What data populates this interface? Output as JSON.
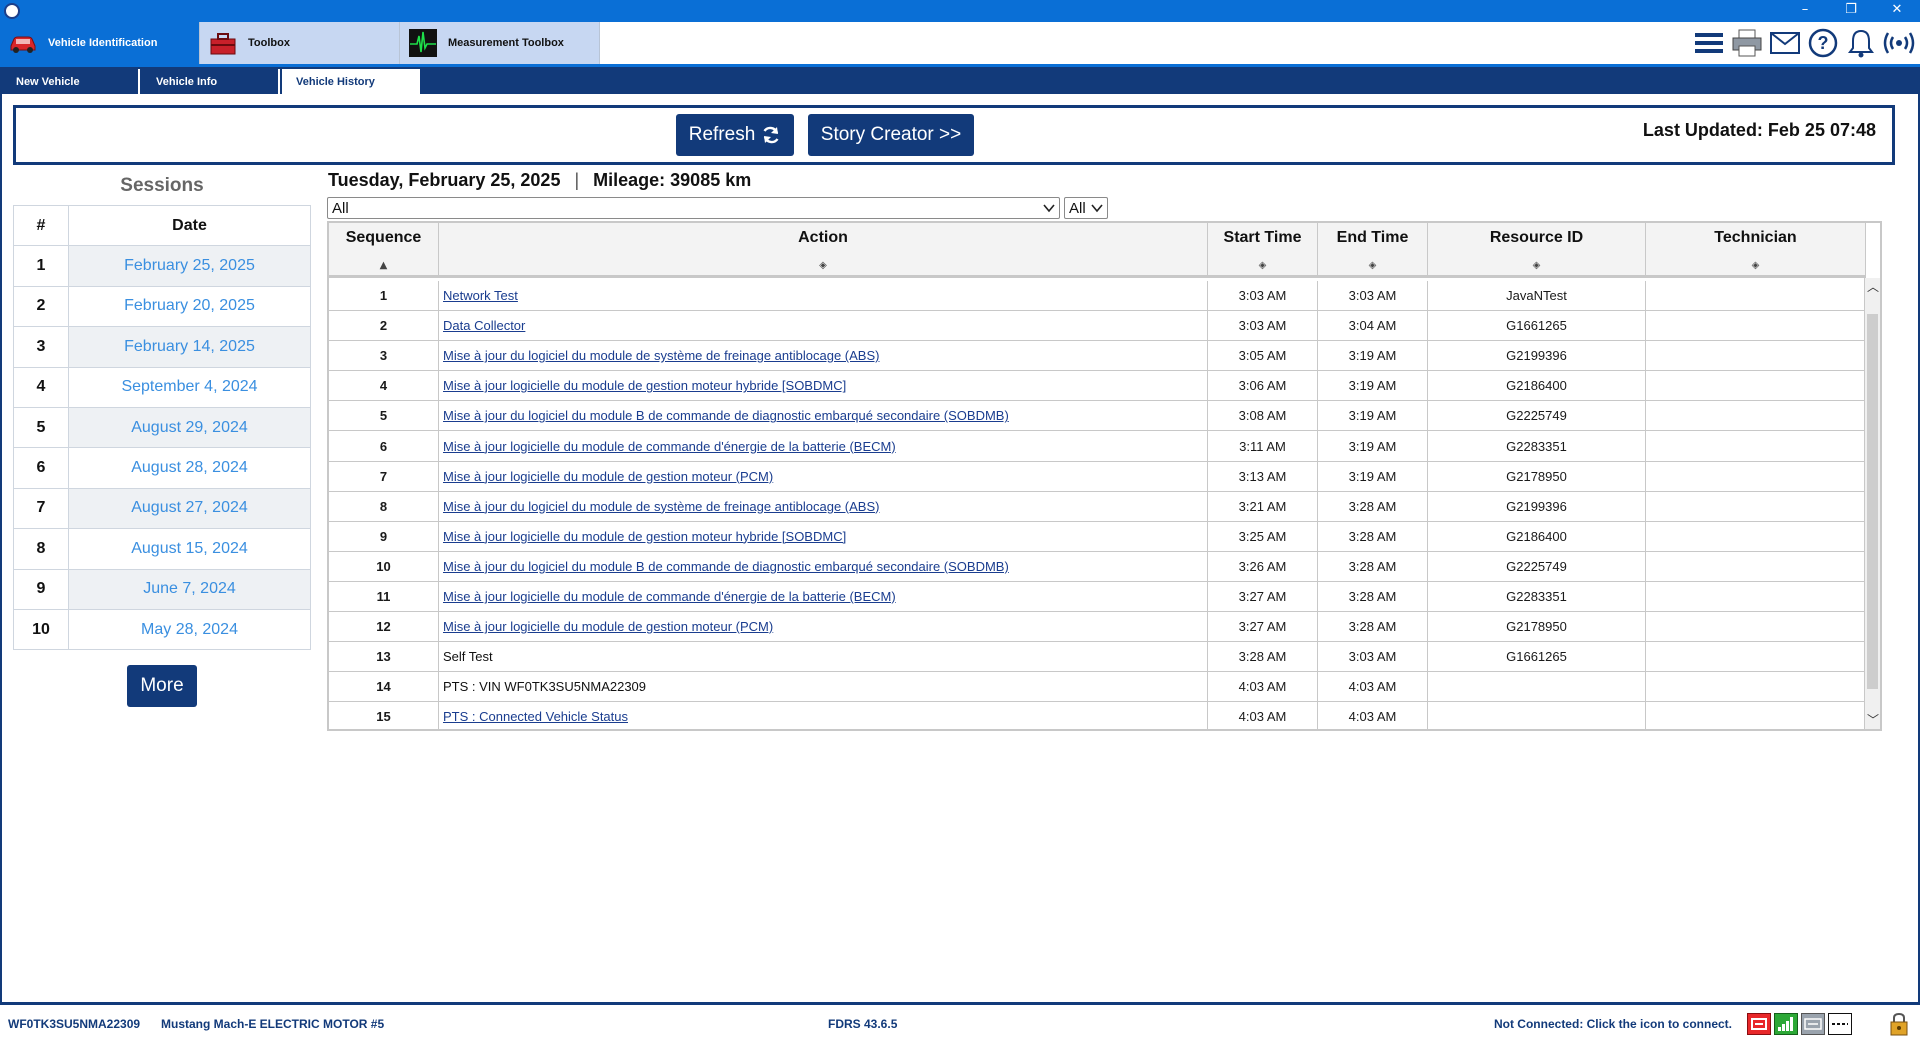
{
  "window": {
    "minimize": "–",
    "restore": "❐",
    "close": "✕"
  },
  "main_tabs": [
    {
      "label": "Vehicle Identification",
      "icon": "car-icon",
      "active": true
    },
    {
      "label": "Toolbox",
      "icon": "toolbox-icon",
      "active": false
    },
    {
      "label": "Measurement Toolbox",
      "icon": "oscilloscope-icon",
      "active": false
    }
  ],
  "tool_icons": [
    "menu-icon",
    "printer-icon",
    "mail-icon",
    "help-icon",
    "bell-icon",
    "broadcast-icon"
  ],
  "sub_tabs": [
    {
      "label": "New Vehicle",
      "active": false
    },
    {
      "label": "Vehicle Info",
      "active": false
    },
    {
      "label": "Vehicle History",
      "active": true
    }
  ],
  "actions": {
    "refresh_label": "Refresh",
    "story_creator_label": "Story Creator >>",
    "last_updated": "Last Updated: Feb 25 07:48"
  },
  "sessions": {
    "title": "Sessions",
    "col_num": "#",
    "col_date": "Date",
    "rows": [
      {
        "num": "1",
        "date": "February 25, 2025"
      },
      {
        "num": "2",
        "date": "February 20, 2025"
      },
      {
        "num": "3",
        "date": "February 14, 2025"
      },
      {
        "num": "4",
        "date": "September 4, 2024"
      },
      {
        "num": "5",
        "date": "August 29, 2024"
      },
      {
        "num": "6",
        "date": "August 28, 2024"
      },
      {
        "num": "7",
        "date": "August 27, 2024"
      },
      {
        "num": "8",
        "date": "August 15, 2024"
      },
      {
        "num": "9",
        "date": "June 7, 2024"
      },
      {
        "num": "10",
        "date": "May 28, 2024"
      }
    ],
    "more_label": "More"
  },
  "detail": {
    "date_heading": "Tuesday, February 25, 2025",
    "separator": "|",
    "mileage": "Mileage: 39085 km",
    "filter_main": "All",
    "filter_small": "All"
  },
  "history": {
    "columns": [
      "Sequence",
      "Action",
      "Start Time",
      "End Time",
      "Resource ID",
      "Technician"
    ],
    "rows": [
      {
        "seq": "1",
        "action": "Network Test",
        "link": true,
        "start": "3:03 AM",
        "end": "3:03 AM",
        "resource": "JavaNTest",
        "tech": ""
      },
      {
        "seq": "2",
        "action": "Data Collector",
        "link": true,
        "start": "3:03 AM",
        "end": "3:04 AM",
        "resource": "G1661265",
        "tech": ""
      },
      {
        "seq": "3",
        "action": "Mise à jour du logiciel du module de système de freinage antiblocage (ABS)",
        "link": true,
        "start": "3:05 AM",
        "end": "3:19 AM",
        "resource": "G2199396",
        "tech": ""
      },
      {
        "seq": "4",
        "action": "Mise à jour logicielle du module de gestion moteur hybride [SOBDMC]",
        "link": true,
        "start": "3:06 AM",
        "end": "3:19 AM",
        "resource": "G2186400",
        "tech": ""
      },
      {
        "seq": "5",
        "action": "Mise à jour du logiciel du module B de commande de diagnostic embarqué secondaire (SOBDMB)",
        "link": true,
        "start": "3:08 AM",
        "end": "3:19 AM",
        "resource": "G2225749",
        "tech": ""
      },
      {
        "seq": "6",
        "action": "Mise à jour logicielle du module de commande d'énergie de la batterie (BECM)",
        "link": true,
        "start": "3:11 AM",
        "end": "3:19 AM",
        "resource": "G2283351",
        "tech": ""
      },
      {
        "seq": "7",
        "action": "Mise à jour logicielle du module de gestion moteur (PCM)",
        "link": true,
        "start": "3:13 AM",
        "end": "3:19 AM",
        "resource": "G2178950",
        "tech": ""
      },
      {
        "seq": "8",
        "action": "Mise à jour du logiciel du module de système de freinage antiblocage (ABS)",
        "link": true,
        "start": "3:21 AM",
        "end": "3:28 AM",
        "resource": "G2199396",
        "tech": ""
      },
      {
        "seq": "9",
        "action": "Mise à jour logicielle du module de gestion moteur hybride [SOBDMC]",
        "link": true,
        "start": "3:25 AM",
        "end": "3:28 AM",
        "resource": "G2186400",
        "tech": ""
      },
      {
        "seq": "10",
        "action": "Mise à jour du logiciel du module B de commande de diagnostic embarqué secondaire (SOBDMB)",
        "link": true,
        "start": "3:26 AM",
        "end": "3:28 AM",
        "resource": "G2225749",
        "tech": ""
      },
      {
        "seq": "11",
        "action": "Mise à jour logicielle du module de commande d'énergie de la batterie (BECM)",
        "link": true,
        "start": "3:27 AM",
        "end": "3:28 AM",
        "resource": "G2283351",
        "tech": ""
      },
      {
        "seq": "12",
        "action": "Mise à jour logicielle du module de gestion moteur (PCM)",
        "link": true,
        "start": "3:27 AM",
        "end": "3:28 AM",
        "resource": "G2178950",
        "tech": ""
      },
      {
        "seq": "13",
        "action": "Self Test",
        "link": false,
        "start": "3:28 AM",
        "end": "3:03 AM",
        "resource": "G1661265",
        "tech": ""
      },
      {
        "seq": "14",
        "action": "PTS : VIN WF0TK3SU5NMA22309",
        "link": false,
        "start": "4:03 AM",
        "end": "4:03 AM",
        "resource": "",
        "tech": ""
      },
      {
        "seq": "15",
        "action": "PTS : Connected Vehicle Status",
        "link": true,
        "start": "4:03 AM",
        "end": "4:03 AM",
        "resource": "",
        "tech": ""
      }
    ]
  },
  "status": {
    "vin": "WF0TK3SU5NMA22309",
    "vehicle": "Mustang Mach-E ELECTRIC MOTOR #5",
    "version": "FDRS 43.6.5",
    "connection": "Not Connected: Click the icon to connect."
  },
  "colors": {
    "accent_blue": "#0a6fd6",
    "navy": "#123a7a",
    "link": "#1a3d8f",
    "date_blue": "#3a8fe0"
  }
}
